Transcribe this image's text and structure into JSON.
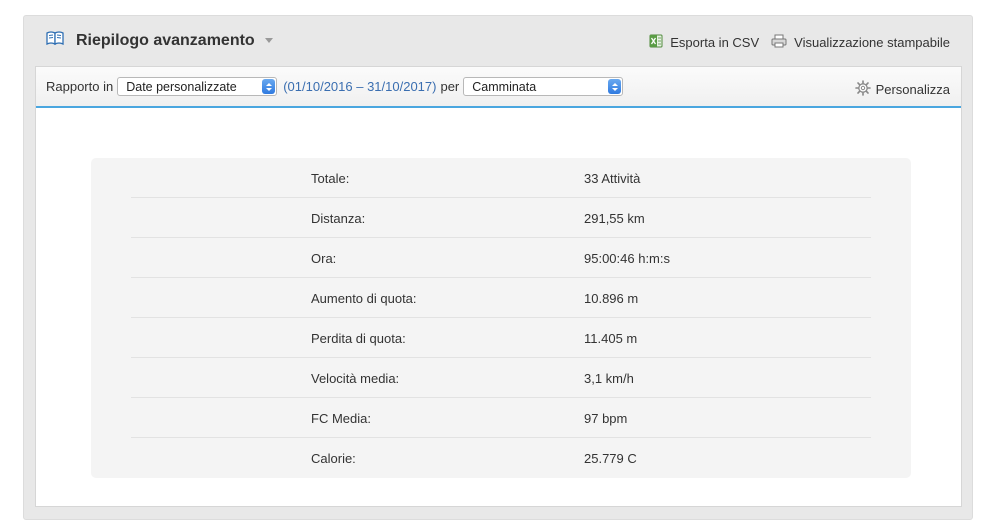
{
  "header": {
    "title": "Riepilogo avanzamento",
    "export_csv": "Esporta in CSV",
    "printable_view": "Visualizzazione stampabile"
  },
  "toolbar": {
    "report_in_label": "Rapporto in",
    "period_select": "Date personalizzate",
    "date_range": "(01/10/2016 – 31/10/2017)",
    "per_label": "per",
    "activity_select": "Camminata",
    "customize": "Personalizza"
  },
  "stats": [
    {
      "label": "Totale:",
      "value": "33 Attività"
    },
    {
      "label": "Distanza:",
      "value": "291,55 km"
    },
    {
      "label": "Ora:",
      "value": "95:00:46 h:m:s"
    },
    {
      "label": "Aumento di quota:",
      "value": "10.896 m"
    },
    {
      "label": "Perdita di quota:",
      "value": "11.405 m"
    },
    {
      "label": "Velocità media:",
      "value": "3,1 km/h"
    },
    {
      "label": "FC Media:",
      "value": "97 bpm"
    },
    {
      "label": "Calorie:",
      "value": "25.779 C"
    }
  ],
  "colors": {
    "accent_line": "#4aa6df",
    "date_range_text": "#3a6eb0",
    "select_arrow": "#2f7ae0"
  }
}
